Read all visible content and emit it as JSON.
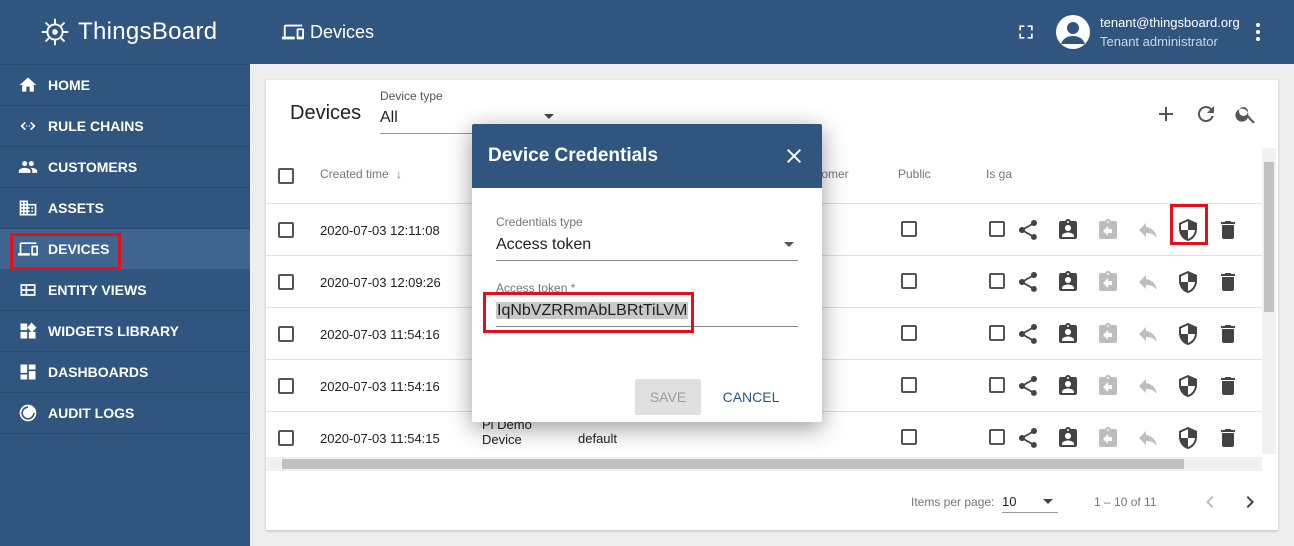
{
  "app": {
    "name": "ThingsBoard"
  },
  "sidebar": {
    "items": [
      {
        "label": "HOME",
        "icon": "home-icon"
      },
      {
        "label": "RULE CHAINS",
        "icon": "rule-chains-icon"
      },
      {
        "label": "CUSTOMERS",
        "icon": "customers-icon"
      },
      {
        "label": "ASSETS",
        "icon": "assets-icon"
      },
      {
        "label": "DEVICES",
        "icon": "devices-icon"
      },
      {
        "label": "ENTITY VIEWS",
        "icon": "entity-views-icon"
      },
      {
        "label": "WIDGETS LIBRARY",
        "icon": "widgets-icon"
      },
      {
        "label": "DASHBOARDS",
        "icon": "dashboards-icon"
      },
      {
        "label": "AUDIT LOGS",
        "icon": "audit-logs-icon"
      }
    ],
    "active_index": 4
  },
  "topbar": {
    "title": "Devices",
    "user_email": "tenant@thingsboard.org",
    "user_role": "Tenant administrator"
  },
  "devices": {
    "title": "Devices",
    "device_type_label": "Device type",
    "device_type_value": "All",
    "columns": {
      "created": "Created time",
      "customer_partial": "tomer",
      "public": "Public",
      "is_gateway_partial": "Is ga"
    },
    "rows": [
      {
        "created": "2020-07-03 12:11:08",
        "name": "",
        "type": ""
      },
      {
        "created": "2020-07-03 12:09:26",
        "name": "",
        "type": ""
      },
      {
        "created": "2020-07-03 11:54:16",
        "name": "",
        "type": ""
      },
      {
        "created": "2020-07-03 11:54:16",
        "name": "",
        "type": ""
      },
      {
        "created": "2020-07-03 11:54:15",
        "name": "Raspberry Pi Demo Device",
        "type": "default"
      }
    ],
    "pager": {
      "items_per_page_label": "Items per page:",
      "items_per_page": "10",
      "range": "1 – 10 of 11"
    }
  },
  "dialog": {
    "title": "Device Credentials",
    "credentials_type_label": "Credentials type",
    "credentials_type_value": "Access token",
    "access_token_label": "Access token *",
    "access_token_value": "IqNbVZRRmAbLBRtTiLVM",
    "save_label": "SAVE",
    "cancel_label": "CANCEL"
  },
  "colors": {
    "primary": "#305680",
    "highlight": "#e0101c"
  }
}
